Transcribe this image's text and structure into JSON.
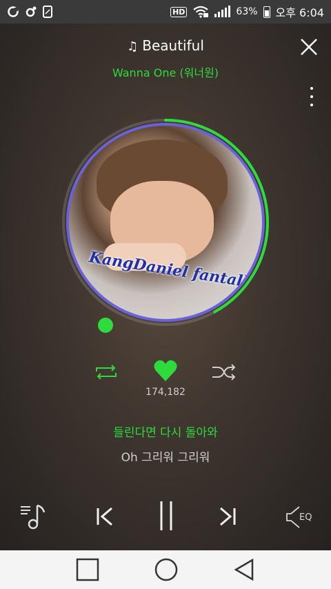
{
  "status_bar": {
    "battery_percent": "63%",
    "time": "오후 6:04",
    "hd_label": "HD",
    "icons": [
      "cloud-sync-icon",
      "location-icon",
      "screenshot-icon",
      "hd-voice-icon",
      "wifi-icon",
      "signal-icon",
      "battery-icon"
    ]
  },
  "player": {
    "song_title": "Beautiful",
    "artist": "Wanna One (워너원)",
    "album_caption": "KangDaniel fantalk",
    "like_count": "174,182",
    "lyric_current": "들린다면 다시 돌아와",
    "lyric_next": "Oh 그리워 그리워",
    "eq_label": "EQ",
    "progress_fraction": 0.42,
    "accent_color": "#2ddb3d",
    "liked": true
  },
  "nav": {
    "icons": [
      "recents-square-icon",
      "home-circle-icon",
      "back-triangle-icon"
    ]
  }
}
